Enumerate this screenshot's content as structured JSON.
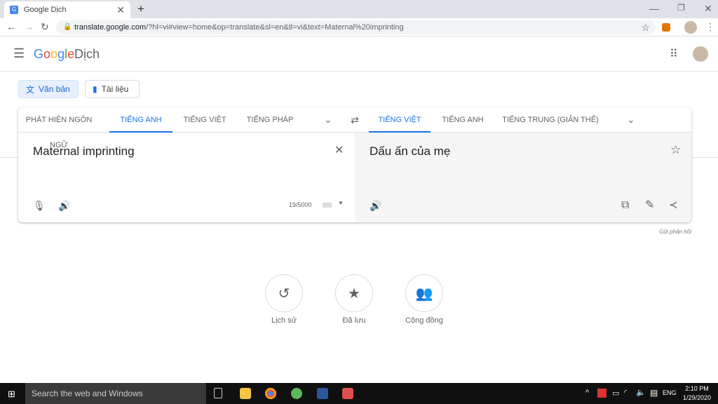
{
  "browser": {
    "tab_title": "Google Dịch",
    "url_host": "translate.google.com",
    "url_path": "/?hl=vi#view=home&op=translate&sl=en&tl=vi&text=Maternal%20imprinting"
  },
  "header": {
    "logo": "Google",
    "title": "Dịch"
  },
  "modes": {
    "text": "Văn bản",
    "documents": "Tài liệu"
  },
  "source_langs": [
    "PHÁT HIỆN NGÔN NGỮ",
    "TIẾNG ANH",
    "TIẾNG VIỆT",
    "TIẾNG PHÁP"
  ],
  "target_langs": [
    "TIẾNG VIỆT",
    "TIẾNG ANH",
    "TIẾNG TRUNG (GIẢN THỂ)"
  ],
  "source_text": "Maternal imprinting",
  "char_count": "19/5000",
  "translation": "Dấu ấn của mẹ",
  "feedback": "Gửi phản hồi",
  "shortcuts": [
    "Lịch sử",
    "Đã lưu",
    "Cộng đồng"
  ],
  "taskbar": {
    "search": "Search the web and Windows",
    "lang": "ENG",
    "time": "2:10 PM",
    "date": "1/29/2020"
  }
}
